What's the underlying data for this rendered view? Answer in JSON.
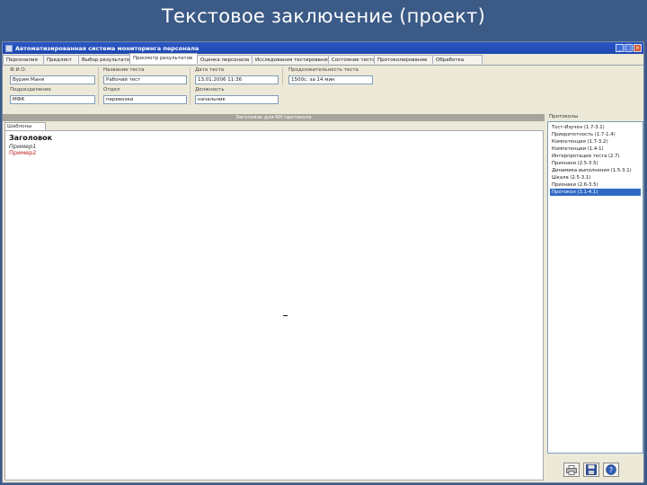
{
  "slide": {
    "title": "Текстовое заключение (проект)"
  },
  "window": {
    "title": "Автоматизированная система мониторинга персонала",
    "controls": {
      "minimize": "_",
      "maximize": "□",
      "close": "×"
    }
  },
  "tabs": [
    {
      "label": "Персоналия"
    },
    {
      "label": "Предлист"
    },
    {
      "label": "Выбор результатов"
    },
    {
      "label": "Просмотр результатов"
    },
    {
      "label": "Оценка персонала"
    },
    {
      "label": "Исследования тестирования"
    },
    {
      "label": "Состояние тестов"
    },
    {
      "label": "Протоколирование"
    },
    {
      "label": "Обработка"
    }
  ],
  "fields": {
    "fio": {
      "label": "Ф.И.О.",
      "value": "Вурим Маня"
    },
    "test_name": {
      "label": "Название теста",
      "value": "Рабочий тест"
    },
    "test_date": {
      "label": "Дата теста",
      "value": "13.01.2006 11:36"
    },
    "duration": {
      "label": "Продолжительность теста",
      "value": "1500с. за 14 мин"
    },
    "subdivision": {
      "label": "Подразделение",
      "value": "МФК"
    },
    "department": {
      "label": "Отдел",
      "value": "перевозки"
    },
    "position": {
      "label": "Должность",
      "value": "начальник"
    }
  },
  "section_header": "Заголовок для RH протокола",
  "doc_tab": "Шаблоны",
  "editor": {
    "heading": "Заголовок",
    "line1": "Пример1",
    "line2": "Пример2"
  },
  "right_panel": {
    "label": "Протоколы",
    "items": [
      "Тест-Изучен (1.7-3.1)",
      "Приоритетность (1.7-1.4)",
      "Компетенция (1.7-3.2)",
      "Компетенции (1.4-1)",
      "Интерпретации теста (2.7)",
      "Признаки (2.5-3.5)",
      "Динамика выполнения (1.5-3.1)",
      "Шкала (2.5-3.1)",
      "Признаки (2.6-3.5)",
      "Протокол (3.1-4.1)"
    ],
    "selected_index": 9
  },
  "icons": {
    "print": "printer-icon",
    "save": "floppy-disk-icon",
    "help": "help-icon"
  },
  "colors": {
    "slide_bg": "#3b5a86",
    "titlebar": "#1d47b0",
    "selection": "#316ac5",
    "example2": "#c01818"
  }
}
